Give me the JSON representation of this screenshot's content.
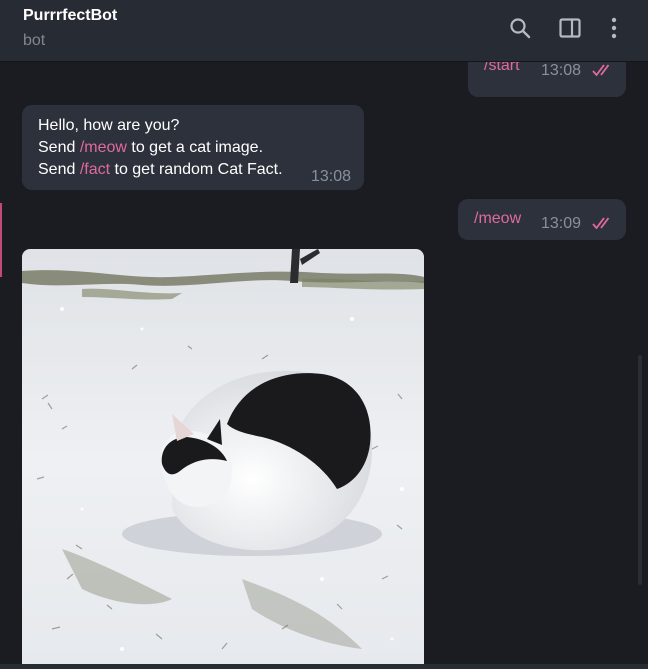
{
  "header": {
    "title": "PurrrfectBot",
    "status": "bot",
    "search_icon": "search-icon",
    "sidebar_icon": "sidebar-toggle-icon",
    "menu_icon": "more-vertical-icon"
  },
  "messages": [
    {
      "direction": "out",
      "text": "/start",
      "time": "13:08",
      "status_icon": "double-check-icon"
    },
    {
      "direction": "in",
      "line1": "Hello, how are you?",
      "line2_prefix": "Send ",
      "line2_cmd": "/meow",
      "line2_suffix": " to get a cat image.",
      "line3_prefix": "Send ",
      "line3_cmd": "/fact",
      "line3_suffix": " to get random Cat Fact.",
      "time": "13:08"
    },
    {
      "direction": "out",
      "text": "/meow",
      "time": "13:09",
      "status_icon": "double-check-icon"
    },
    {
      "direction": "in",
      "type": "photo",
      "description_icon": "cat-photo"
    }
  ],
  "colors": {
    "background": "#1a1c21",
    "header": "#272b33",
    "bubble": "#2c313b",
    "command": "#e06a9f",
    "accent": "#c14a78",
    "time": "#8a9099"
  }
}
